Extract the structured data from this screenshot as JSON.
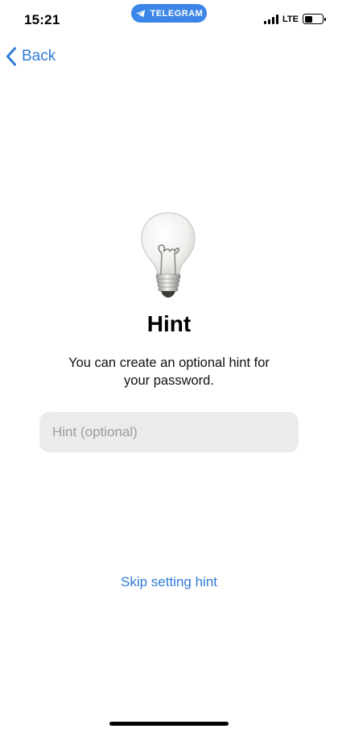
{
  "status_bar": {
    "time": "15:21",
    "pill_label": "TELEGRAM",
    "pill_icon": "telegram-plane-icon",
    "network": "LTE",
    "battery_level": 0.45
  },
  "nav": {
    "back_label": "Back",
    "back_icon": "chevron-left-icon"
  },
  "main": {
    "icon": "light-bulb-icon",
    "title": "Hint",
    "description": "You can create an optional hint for your password.",
    "hint_input": {
      "value": "",
      "placeholder": "Hint (optional)"
    },
    "skip_label": "Skip setting hint"
  },
  "colors": {
    "accent": "#2f7bd8",
    "pill": "#3b86e6",
    "field_bg": "#ebebeb"
  }
}
